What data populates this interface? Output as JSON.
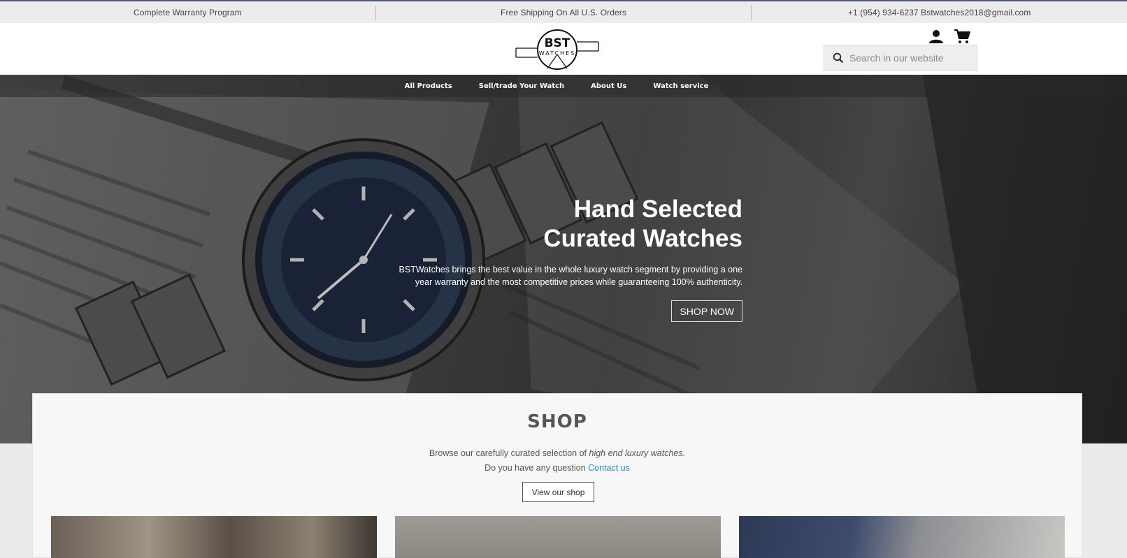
{
  "topbar": {
    "warranty": "Complete Warranty Program",
    "shipping": "Free Shipping On All U.S. Orders",
    "contact": "+1 (954) 934-6237 Bstwatches2018@gmail.com"
  },
  "header": {
    "logo_text": "BST",
    "logo_subtext": "WATCHES",
    "search_placeholder": "Search in our website"
  },
  "nav": {
    "items": [
      "All Products",
      "Sell/trade Your Watch",
      "About Us",
      "Watch service"
    ]
  },
  "hero": {
    "title_line1": "Hand Selected",
    "title_line2": "Curated Watches",
    "subtitle_line1": "BSTWatches brings the best value in the whole luxury watch segment by providing a one",
    "subtitle_line2": "year warranty and the most competitive prices while guaranteeing 100% authenticity.",
    "cta": "SHOP NOW"
  },
  "shop": {
    "title": "SHOP",
    "line1_prefix": "Browse our carefully curated selection of ",
    "line1_emphasis": "high end luxury watches.",
    "line2_prefix": "Do you have any question ",
    "line2_link": "Contact us",
    "button": "View our shop"
  },
  "colors": {
    "link": "#2a8ad4",
    "topbar_bg": "#ececec",
    "hero_dark": "#3b3b3b"
  },
  "icons": [
    "search-icon",
    "user-icon",
    "cart-icon"
  ]
}
